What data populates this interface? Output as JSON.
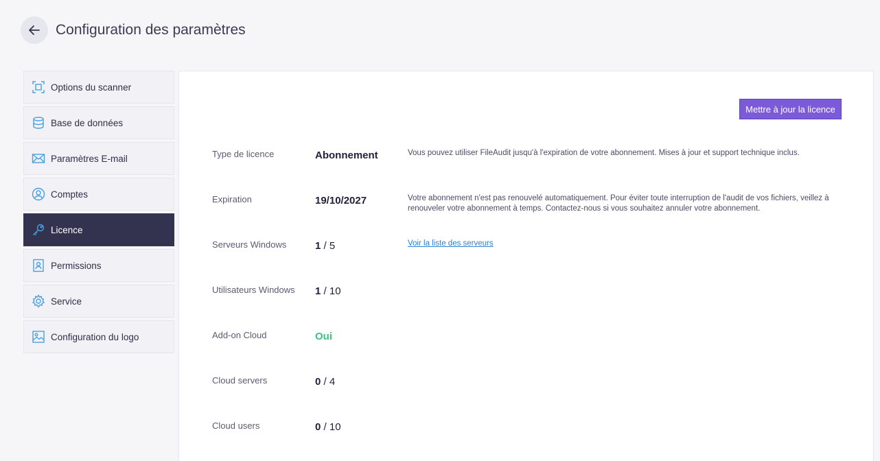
{
  "header": {
    "title": "Configuration des paramètres"
  },
  "sidebar": {
    "items": [
      {
        "label": "Options du scanner",
        "icon": "scan-icon"
      },
      {
        "label": "Base de données",
        "icon": "database-icon"
      },
      {
        "label": "Paramètres E-mail",
        "icon": "mail-icon"
      },
      {
        "label": "Comptes",
        "icon": "user-circle-icon"
      },
      {
        "label": "Licence",
        "icon": "key-icon",
        "active": true
      },
      {
        "label": "Permissions",
        "icon": "badge-icon"
      },
      {
        "label": "Service",
        "icon": "gear-icon"
      },
      {
        "label": "Configuration du logo",
        "icon": "image-icon"
      }
    ]
  },
  "license": {
    "update_button": "Mettre à jour la licence",
    "type": {
      "label": "Type de licence",
      "value": "Abonnement",
      "desc": "Vous pouvez utiliser FileAudit jusqu'à l'expiration de votre abonnement. Mises à jour et support technique inclus."
    },
    "expiration": {
      "label": "Expiration",
      "value": "19/10/2027",
      "desc": "Votre abonnement n'est pas renouvelé automatiquement. Pour éviter toute interruption de l'audit de vos fichiers, veillez à renouveler votre abonnement à temps. Contactez-nous si vous souhaitez annuler votre abonnement."
    },
    "windows_servers": {
      "label": "Serveurs Windows",
      "used": "1",
      "total": "/ 5",
      "link": "Voir la liste des serveurs"
    },
    "windows_users": {
      "label": "Utilisateurs Windows",
      "used": "1",
      "total": "/ 10"
    },
    "cloud_addon": {
      "label": "Add-on Cloud",
      "value": "Oui"
    },
    "cloud_servers": {
      "label": "Cloud servers",
      "used": "0",
      "total": "/ 4"
    },
    "cloud_users": {
      "label": "Cloud users",
      "used": "0",
      "total": "/ 10"
    }
  },
  "colors": {
    "accent": "#7b5bd8",
    "active_nav": "#33334f",
    "icon_blue": "#4a9fe0",
    "success": "#3cc27a",
    "link": "#2b7fd4"
  }
}
